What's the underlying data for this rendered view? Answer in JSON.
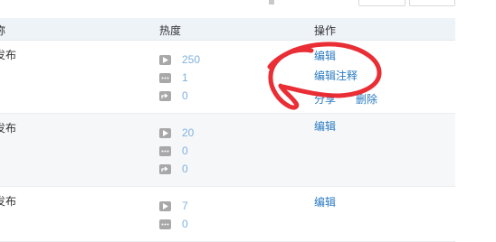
{
  "table": {
    "headers": {
      "name": "称",
      "hot": "热度",
      "op": "操作"
    },
    "rows": [
      {
        "name": "发布",
        "views": "250",
        "comments": "1",
        "shares": "0",
        "actions": {
          "edit": "编辑",
          "edit_notes": "编辑注释",
          "share": "分享",
          "delete": "删除"
        }
      },
      {
        "name": "发布",
        "views": "20",
        "comments": "0",
        "shares": "0",
        "actions": {
          "edit": "编辑"
        }
      },
      {
        "name": "发布",
        "views": "7",
        "comments": "0",
        "actions": {
          "edit": "编辑"
        }
      }
    ]
  },
  "icons": {
    "views": "play-icon",
    "comments": "comment-icon",
    "shares": "share-icon"
  },
  "colors": {
    "link": "#2a7ac2",
    "count": "#7fb2dc",
    "header_bg": "#eef3f8",
    "annotation": "#e8232a"
  }
}
